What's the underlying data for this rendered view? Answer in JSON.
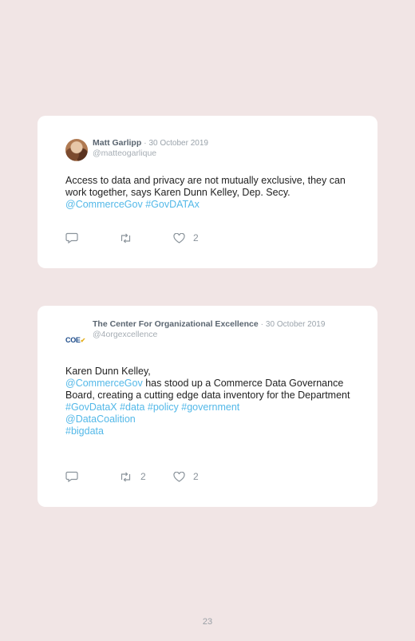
{
  "tweets": [
    {
      "author": "Matt Garlipp",
      "separator": "·",
      "date": "30 October 2019",
      "handle": "@matteogarlique",
      "text": "Access to data and privacy are not mutually exclusive, they can work together, says Karen Dunn Kelley, Dep. Secy.",
      "links": [
        "@CommerceGov",
        "#GovDATAx"
      ],
      "retweets": "",
      "likes": "2"
    },
    {
      "author": "The Center For Organizational Excellence",
      "separator": "·",
      "date": "30 October 2019",
      "handle": "@4orgexcellence",
      "logo_text": "COE",
      "line1": "Karen Dunn Kelley,",
      "mention": "@CommerceGov",
      "line2": " has stood up a Commerce Data Governance Board, creating a cutting edge data inventory for the Department",
      "hashtags": [
        "#GovDataX",
        "#data",
        "#policy",
        "#government"
      ],
      "mention2": "@DataCoalition",
      "hashtag_last": "#bigdata",
      "retweets": "2",
      "likes": "2"
    }
  ],
  "icons": {
    "reply": "reply-icon",
    "retweet": "retweet-icon",
    "like": "heart-icon"
  },
  "page_number": "23"
}
